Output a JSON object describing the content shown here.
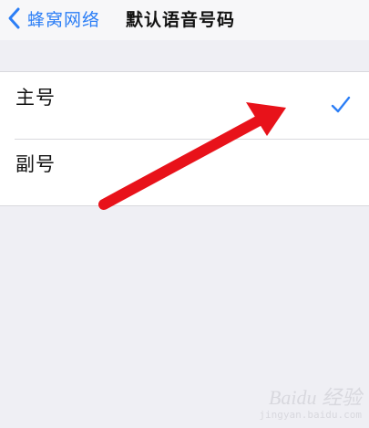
{
  "nav": {
    "back_label": "蜂窝网络",
    "title": "默认语音号码"
  },
  "options": [
    {
      "label": "主号",
      "selected": true
    },
    {
      "label": "副号",
      "selected": false
    }
  ],
  "colors": {
    "accent": "#2b7ef6",
    "background": "#efeff4",
    "annotation_arrow": "#e8121a"
  },
  "annotation": {
    "type": "red-arrow",
    "points_to": "主号"
  },
  "watermark": {
    "main": "Baidu 经验",
    "sub": "jingyan.baidu.com"
  }
}
